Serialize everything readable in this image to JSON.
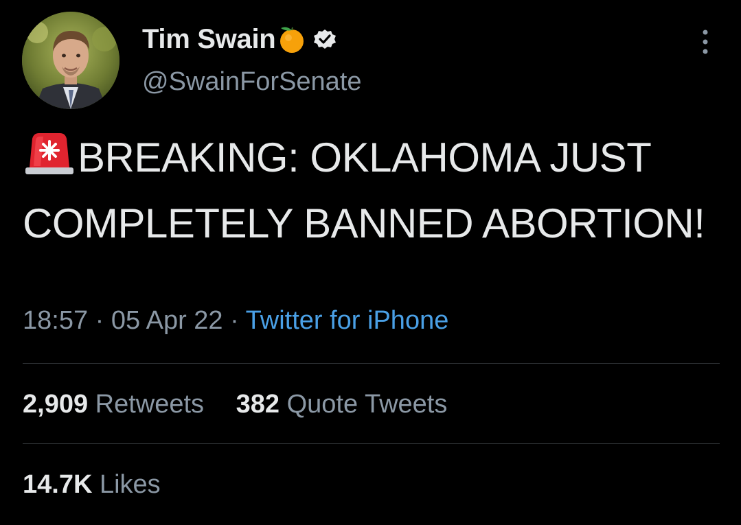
{
  "author": {
    "display_name": "Tim Swain",
    "handle": "@SwainForSenate",
    "badge_icon": "orange-emoji-icon",
    "verified_icon": "verified-badge-icon"
  },
  "tweet": {
    "emoji_icon": "police-siren-icon",
    "text": "BREAKING: OKLAHOMA JUST COMPLETELY BANNED ABORTION!",
    "time": "18:57",
    "separator": "·",
    "date": "05 Apr 22",
    "source": "Twitter for iPhone"
  },
  "stats": {
    "retweets_count": "2,909",
    "retweets_label": "Retweets",
    "quotes_count": "382",
    "quotes_label": "Quote Tweets",
    "likes_count": "14.7K",
    "likes_label": "Likes"
  },
  "colors": {
    "background": "#000000",
    "primary_text": "#e7e9ea",
    "secondary_text": "#8b98a5",
    "link": "#4aa0e6",
    "divider": "#2f3336"
  }
}
